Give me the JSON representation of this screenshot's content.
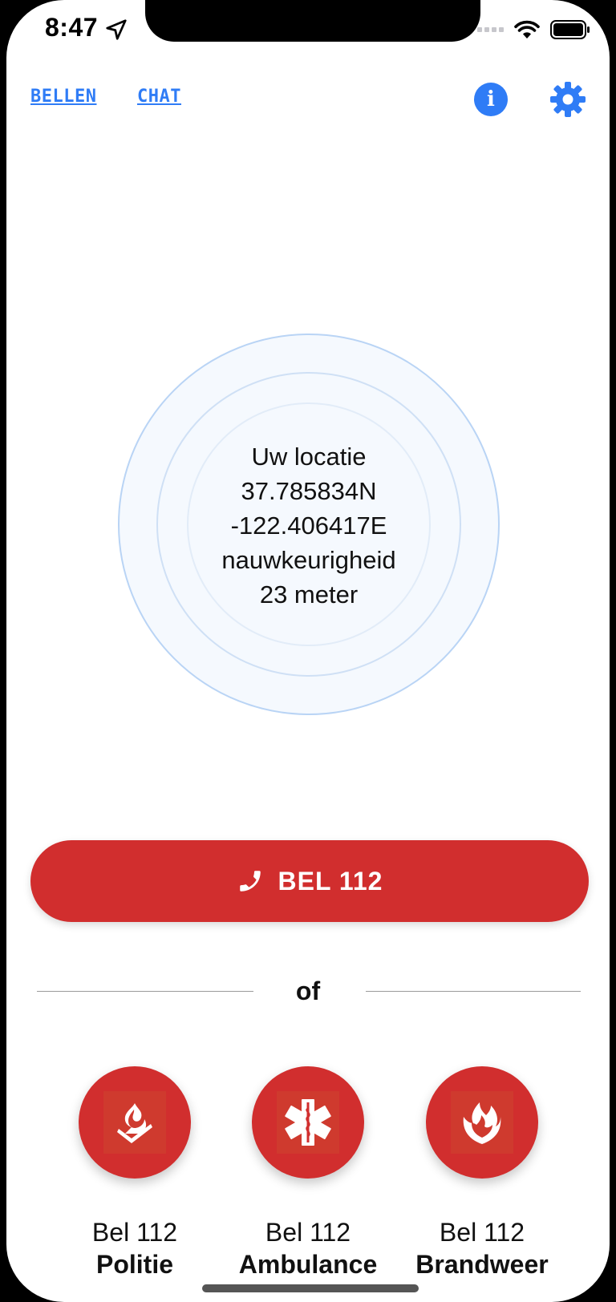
{
  "status_bar": {
    "time": "8:47"
  },
  "nav": {
    "call_link": "BELLEN",
    "chat_link": "CHAT",
    "info_icon": "info-icon",
    "settings_icon": "gear-icon"
  },
  "location": {
    "title": "Uw locatie",
    "latitude": "37.785834N",
    "longitude": "-122.406417E",
    "accuracy_label": "nauwkeurigheid",
    "accuracy_value": "23 meter"
  },
  "call_button": {
    "label": "BEL 112",
    "icon": "phone-icon"
  },
  "divider": {
    "label": "of"
  },
  "services": [
    {
      "line1": "Bel 112",
      "line2": "Politie",
      "icon": "police-icon"
    },
    {
      "line1": "Bel 112",
      "line2": "Ambulance",
      "icon": "star-of-life-icon"
    },
    {
      "line1": "Bel 112",
      "line2": "Brandweer",
      "icon": "fire-department-icon"
    }
  ],
  "colors": {
    "accent_blue": "#2f7cf6",
    "emergency_red": "#d12e2e",
    "circle_border": "#b9d4f5"
  }
}
